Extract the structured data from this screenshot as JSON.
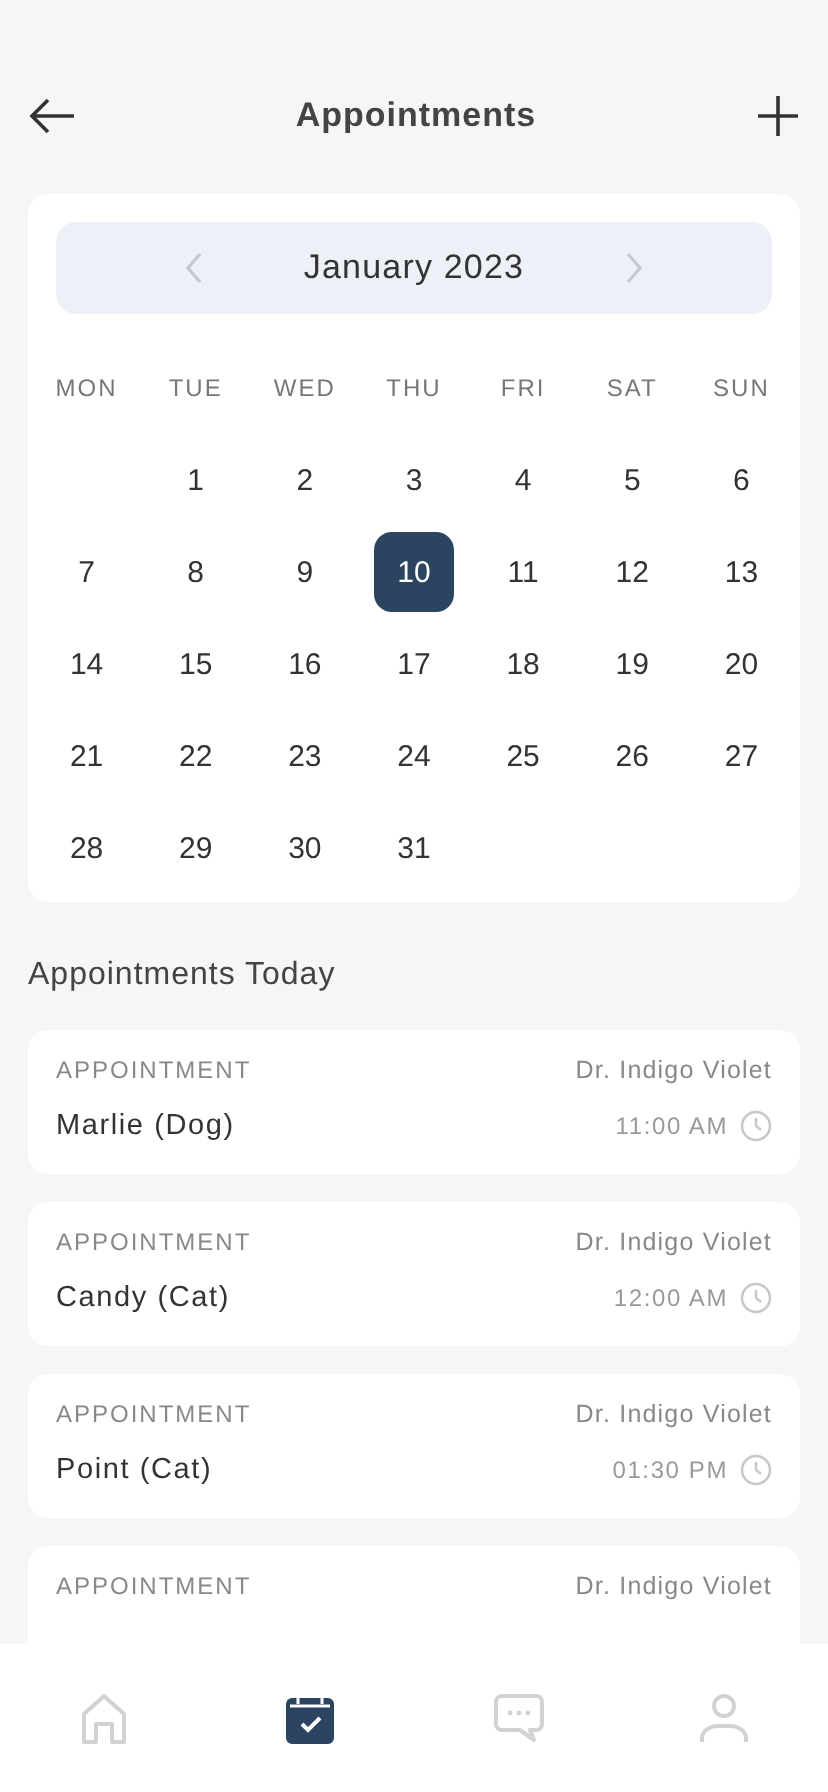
{
  "header": {
    "title": "Appointments"
  },
  "calendar": {
    "month": "January 2023",
    "weekdays": [
      "MON",
      "TUE",
      "WED",
      "THU",
      "FRI",
      "SAT",
      "SUN"
    ],
    "weeks": [
      [
        {
          "kind": "blank"
        },
        {
          "kind": "day",
          "label": "1",
          "selected": false
        },
        {
          "kind": "day",
          "label": "2",
          "selected": false
        },
        {
          "kind": "day",
          "label": "3",
          "selected": false
        },
        {
          "kind": "day",
          "label": "4",
          "selected": false
        },
        {
          "kind": "day",
          "label": "5",
          "selected": false
        },
        {
          "kind": "day",
          "label": "6",
          "selected": false
        }
      ],
      [
        {
          "kind": "day",
          "label": "7",
          "selected": false
        },
        {
          "kind": "day",
          "label": "8",
          "selected": false
        },
        {
          "kind": "day",
          "label": "9",
          "selected": false
        },
        {
          "kind": "day",
          "label": "10",
          "selected": true
        },
        {
          "kind": "day",
          "label": "11",
          "selected": false
        },
        {
          "kind": "day",
          "label": "12",
          "selected": false
        },
        {
          "kind": "day",
          "label": "13",
          "selected": false
        }
      ],
      [
        {
          "kind": "day",
          "label": "14",
          "selected": false
        },
        {
          "kind": "day",
          "label": "15",
          "selected": false
        },
        {
          "kind": "day",
          "label": "16",
          "selected": false
        },
        {
          "kind": "day",
          "label": "17",
          "selected": false
        },
        {
          "kind": "day",
          "label": "18",
          "selected": false
        },
        {
          "kind": "day",
          "label": "19",
          "selected": false
        },
        {
          "kind": "day",
          "label": "20",
          "selected": false
        }
      ],
      [
        {
          "kind": "day",
          "label": "21",
          "selected": false
        },
        {
          "kind": "day",
          "label": "22",
          "selected": false
        },
        {
          "kind": "day",
          "label": "23",
          "selected": false
        },
        {
          "kind": "day",
          "label": "24",
          "selected": false
        },
        {
          "kind": "day",
          "label": "25",
          "selected": false
        },
        {
          "kind": "day",
          "label": "26",
          "selected": false
        },
        {
          "kind": "day",
          "label": "27",
          "selected": false
        }
      ],
      [
        {
          "kind": "day",
          "label": "28",
          "selected": false
        },
        {
          "kind": "day",
          "label": "29",
          "selected": false
        },
        {
          "kind": "day",
          "label": "30",
          "selected": false
        },
        {
          "kind": "day",
          "label": "31",
          "selected": false
        }
      ]
    ]
  },
  "section_title": "Appointments Today",
  "appointments": [
    {
      "label": "APPOINTMENT",
      "doctor": "Dr. Indigo Violet",
      "patient": "Marlie (Dog)",
      "time": "11:00 AM"
    },
    {
      "label": "APPOINTMENT",
      "doctor": "Dr. Indigo Violet",
      "patient": "Candy (Cat)",
      "time": "12:00 AM"
    },
    {
      "label": "APPOINTMENT",
      "doctor": "Dr. Indigo Violet",
      "patient": "Point (Cat)",
      "time": "01:30 PM"
    },
    {
      "label": "APPOINTMENT",
      "doctor": "Dr. Indigo Violet"
    }
  ],
  "nav": [
    {
      "kind": "home",
      "selected": false
    },
    {
      "kind": "calendar",
      "selected": true
    },
    {
      "kind": "chat",
      "selected": false
    },
    {
      "kind": "profile",
      "selected": false
    }
  ]
}
